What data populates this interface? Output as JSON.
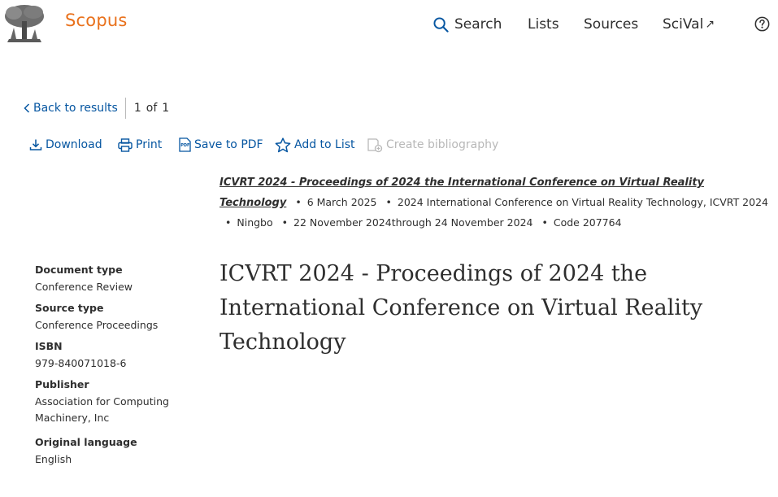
{
  "header": {
    "brand": "Scopus",
    "nav": {
      "search": "Search",
      "lists": "Lists",
      "sources": "Sources",
      "scival": "SciVal",
      "scival_arrow": "↗"
    },
    "icons": [
      "elsevier-tree-logo",
      "search-icon",
      "external-link-icon",
      "help-icon"
    ]
  },
  "results_nav": {
    "back_label": "Back to results",
    "current": "1",
    "of": "of",
    "total": "1"
  },
  "toolbar": {
    "download": "Download",
    "print": "Print",
    "save_pdf": "Save to PDF",
    "add_to_list": "Add to List",
    "create_bibliography": "Create bibliography"
  },
  "source": {
    "title": "ICVRT 2024 - Proceedings of 2024 the International Conference on Virtual Reality Technology",
    "date": "6 March 2025",
    "conference": "2024 International Conference on Virtual Reality Technology, ICVRT 2024",
    "location": "Ningbo",
    "conference_dates": "22 November 2024through 24 November 2024",
    "code": "Code 207764"
  },
  "document": {
    "title": "ICVRT 2024 - Proceedings of 2024 the International Conference on Virtual Reality Technology"
  },
  "metadata": [
    {
      "label": "Document type",
      "value": "Conference Review"
    },
    {
      "label": "Source type",
      "value": "Conference Proceedings"
    },
    {
      "label": "ISBN",
      "value": "979-840071018-6"
    },
    {
      "label": "Publisher",
      "value": "Association for Computing Machinery, Inc"
    },
    {
      "label": "Original language",
      "value": "English"
    }
  ],
  "colors": {
    "brand": "#e9711c",
    "link": "#0656a1",
    "disabled": "#b8b8b8",
    "text": "#2e2e2e"
  }
}
